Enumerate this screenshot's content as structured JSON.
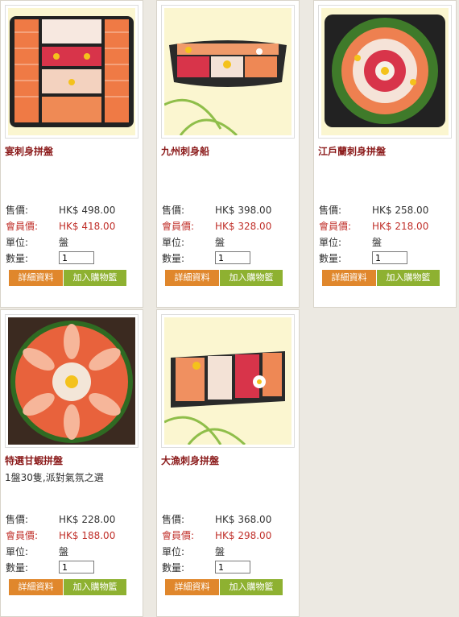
{
  "labels": {
    "price": "售價:",
    "member_price": "會員價:",
    "unit": "單位:",
    "quantity": "數量:",
    "details_button": "詳細資料",
    "cart_button": "加入購物籃"
  },
  "products": [
    {
      "name": "宴刺身拼盤",
      "description": "",
      "price": "HK$ 498.00",
      "member_price": "HK$ 418.00",
      "unit": "盤",
      "qty": "1"
    },
    {
      "name": "九州刺身船",
      "description": "",
      "price": "HK$ 398.00",
      "member_price": "HK$ 328.00",
      "unit": "盤",
      "qty": "1"
    },
    {
      "name": "江戶蘭刺身拼盤",
      "description": "",
      "price": "HK$ 258.00",
      "member_price": "HK$ 218.00",
      "unit": "盤",
      "qty": "1"
    },
    {
      "name": "特選甘蝦拼盤",
      "description": "1盤30隻,派對氣氛之選",
      "price": "HK$ 228.00",
      "member_price": "HK$ 188.00",
      "unit": "盤",
      "qty": "1"
    },
    {
      "name": "大漁刺身拼盤",
      "description": "",
      "price": "HK$ 368.00",
      "member_price": "HK$ 298.00",
      "unit": "盤",
      "qty": "1"
    }
  ]
}
